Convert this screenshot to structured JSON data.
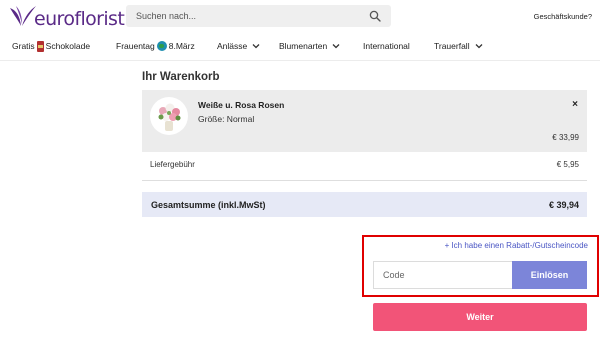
{
  "header": {
    "logo_text": "euroflorist",
    "search_placeholder": "Suchen nach...",
    "business_link": "Geschäftskunde?"
  },
  "nav": {
    "items": [
      {
        "pre": "Gratis",
        "post": "Schokolade",
        "icon": "chocolate-icon"
      },
      {
        "pre": "Frauentag",
        "post": "8.März",
        "icon": "globe-icon"
      },
      {
        "label": "Anlässe",
        "dropdown": true
      },
      {
        "label": "Blumenarten",
        "dropdown": true
      },
      {
        "label": "International",
        "dropdown": false
      },
      {
        "label": "Trauerfall",
        "dropdown": true
      }
    ]
  },
  "cart": {
    "title": "Ihr Warenkorb",
    "item": {
      "name": "Weiße u. Rosa Rosen",
      "size": "Größe: Normal",
      "price": "€ 33,99",
      "remove": "×"
    },
    "fee": {
      "label": "Liefergebühr",
      "value": "€ 5,95"
    },
    "total": {
      "label": "Gesamtsumme (inkl.MwSt)",
      "value": "€ 39,94"
    }
  },
  "coupon": {
    "link": "+ Ich habe einen Rabatt-/Gutscheincode",
    "placeholder": "Code",
    "button": "Einlösen"
  },
  "actions": {
    "continue": "Weiter"
  },
  "colors": {
    "brand": "#5a2a87",
    "redeem": "#7c85d9",
    "continue": "#f25478",
    "link": "#4a56c4",
    "highlight": "#e00000"
  }
}
